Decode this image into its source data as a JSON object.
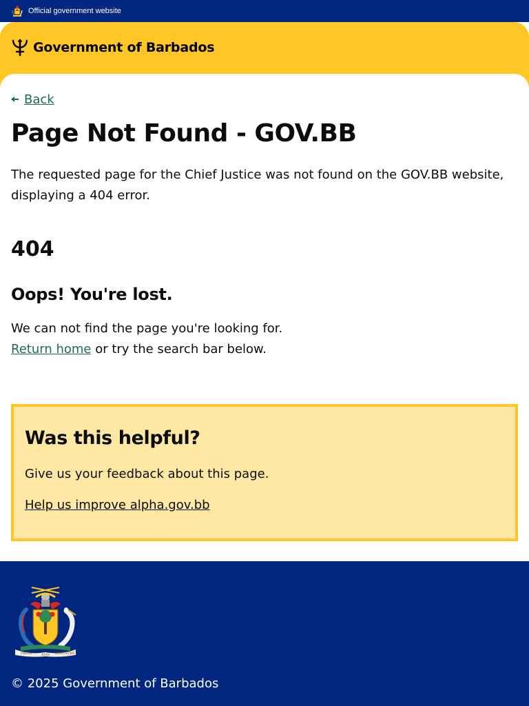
{
  "banner": {
    "official_text": "Official government website"
  },
  "header": {
    "brand_text": "Government of Barbados"
  },
  "main": {
    "back_label": "Back",
    "title": "Page Not Found - GOV.BB",
    "intro": "The requested page for the Chief Justice was not found on the GOV.BB website, displaying a 404 error.",
    "error_code": "404",
    "lost_heading": "Oops! You're lost.",
    "lost_line1": "We can not find the page you're looking for.",
    "return_home_label": "Return home",
    "lost_line2_suffix": " or try the search bar below."
  },
  "feedback": {
    "heading": "Was this helpful?",
    "text": "Give us your feedback about this page.",
    "link_label": "Help us improve alpha.gov.bb"
  },
  "footer": {
    "copyright": "© 2025 Government of Barbados",
    "crest_motto": "PRIDE AND INDUSTRY"
  },
  "colors": {
    "navy": "#00267f",
    "gold": "#ffc726",
    "feedback_bg": "#ffe8a3",
    "link_green": "#1e6b52"
  },
  "icons": {
    "banner_crest": "coat-of-arms-icon",
    "brand": "trident-icon",
    "back": "arrow-left-icon",
    "footer_crest": "coat-of-arms-icon"
  }
}
